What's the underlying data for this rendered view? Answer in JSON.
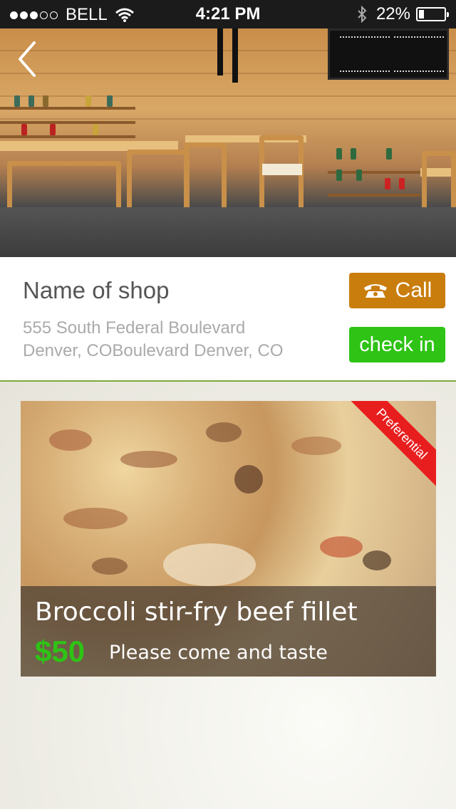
{
  "status_bar": {
    "signal_bars_filled": 3,
    "signal_bars_total": 5,
    "carrier": "BELL",
    "time": "4:21 PM",
    "battery_percent": "22%",
    "battery_level": 0.22
  },
  "hero": {
    "back_icon": "chevron-left-icon"
  },
  "shop": {
    "name": "Name of shop",
    "address_line1": "555 South Federal Boulevard",
    "address_line2": "Denver, COBoulevard Denver, CO",
    "call_label": "Call",
    "call_icon": "phone-icon",
    "call_color": "#c97d0d",
    "checkin_label": "check in",
    "checkin_color": "#2ec315",
    "divider_color": "#7aaa3a"
  },
  "promo": {
    "ribbon_label": "Preferential",
    "ribbon_color": "#e81e1e",
    "dish_name": "Broccoli stir-fry beef fillet",
    "price": "$50",
    "price_color": "#2ec315",
    "tagline": "Please come and taste"
  }
}
